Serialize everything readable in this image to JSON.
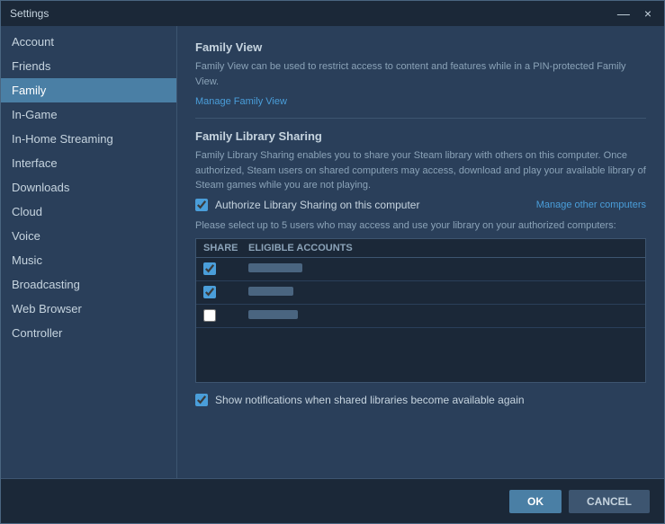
{
  "window": {
    "title": "Settings",
    "close_label": "×",
    "minimize_label": "—"
  },
  "sidebar": {
    "items": [
      {
        "label": "Account",
        "id": "account",
        "active": false
      },
      {
        "label": "Friends",
        "id": "friends",
        "active": false
      },
      {
        "label": "Family",
        "id": "family",
        "active": true
      },
      {
        "label": "In-Game",
        "id": "in-game",
        "active": false
      },
      {
        "label": "In-Home Streaming",
        "id": "in-home-streaming",
        "active": false
      },
      {
        "label": "Interface",
        "id": "interface",
        "active": false
      },
      {
        "label": "Downloads",
        "id": "downloads",
        "active": false
      },
      {
        "label": "Cloud",
        "id": "cloud",
        "active": false
      },
      {
        "label": "Voice",
        "id": "voice",
        "active": false
      },
      {
        "label": "Music",
        "id": "music",
        "active": false
      },
      {
        "label": "Broadcasting",
        "id": "broadcasting",
        "active": false
      },
      {
        "label": "Web Browser",
        "id": "web-browser",
        "active": false
      },
      {
        "label": "Controller",
        "id": "controller",
        "active": false
      }
    ]
  },
  "content": {
    "family_view": {
      "title": "Family View",
      "description": "Family View can be used to restrict access to content and features while in a PIN-protected Family View.",
      "manage_link": "Manage Family View"
    },
    "library_sharing": {
      "title": "Family Library Sharing",
      "description": "Family Library Sharing enables you to share your Steam library with others on this computer. Once authorized, Steam users on shared computers may access, download and play your available library of Steam games while you are not playing.",
      "authorize_label": "Authorize Library Sharing on this computer",
      "manage_link": "Manage other computers",
      "select_text": "Please select up to 5 users who may access and use your library on your authorized computers:",
      "table_headers": {
        "share": "SHARE",
        "accounts": "ELIGIBLE ACCOUNTS"
      },
      "accounts": [
        {
          "checked": true,
          "name_width": 60
        },
        {
          "checked": true,
          "name_width": 50
        },
        {
          "checked": false,
          "name_width": 55
        }
      ],
      "notification_label": "Show notifications when shared libraries become available again"
    }
  },
  "footer": {
    "ok_label": "OK",
    "cancel_label": "CANCEL"
  }
}
